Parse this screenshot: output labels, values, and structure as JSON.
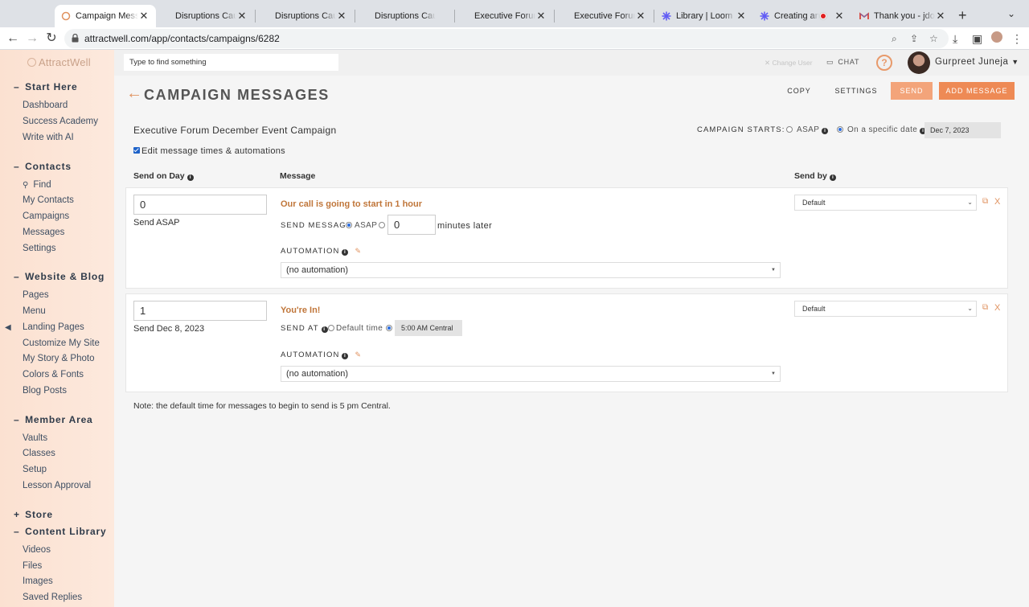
{
  "browser": {
    "tabs": [
      {
        "title": "Campaign Messa",
        "active": true
      },
      {
        "title": "Disruptions Caus",
        "active": false
      },
      {
        "title": "Disruptions Caus",
        "active": false
      },
      {
        "title": "Disruptions Caus",
        "active": false
      },
      {
        "title": "Executive Forum",
        "active": false
      },
      {
        "title": "Executive Forum",
        "active": false
      },
      {
        "title": "Library | Loom",
        "active": false
      },
      {
        "title": "Creating an E",
        "active": false
      },
      {
        "title": "Thank you - jdow",
        "active": false
      }
    ],
    "url": "attractwell.com/app/contacts/campaigns/6282"
  },
  "sidebar": {
    "logo": "AttractWell",
    "sections": [
      {
        "title": "Start Here",
        "symbol": "–",
        "items": [
          "Dashboard",
          "Success Academy",
          "Write with AI"
        ]
      },
      {
        "title": "Contacts",
        "symbol": "–",
        "items": [
          "Find",
          "My Contacts",
          "Campaigns",
          "Messages",
          "Settings"
        ]
      },
      {
        "title": "Website & Blog",
        "symbol": "–",
        "items": [
          "Pages",
          "Menu",
          "Landing Pages",
          "Customize My Site",
          "My Story & Photo",
          "Colors & Fonts",
          "Blog Posts"
        ]
      },
      {
        "title": "Member Area",
        "symbol": "–",
        "items": [
          "Vaults",
          "Classes",
          "Setup",
          "Lesson Approval"
        ]
      },
      {
        "title": "Store",
        "symbol": "+",
        "items": []
      },
      {
        "title": "Content Library",
        "symbol": "–",
        "items": [
          "Videos",
          "Files",
          "Images",
          "Saved Replies"
        ]
      }
    ]
  },
  "topbar": {
    "search_placeholder": "Type to find something",
    "change_user": "Change User",
    "chat": "CHAT",
    "help": "?",
    "user_name": "Gurpreet Juneja"
  },
  "header": {
    "title": "CAMPAIGN MESSAGES",
    "copy": "COPY",
    "settings": "SETTINGS",
    "send": "SEND",
    "add_message": "ADD MESSAGE"
  },
  "campaign": {
    "name": "Executive Forum December Event Campaign",
    "starts_label": "CAMPAIGN STARTS:",
    "asap_label": "ASAP",
    "specific_label": "On a specific date",
    "start_date": "Dec 7, 2023",
    "edit_label": "Edit message times & automations"
  },
  "columns": {
    "day": "Send on Day",
    "message": "Message",
    "send_by": "Send by"
  },
  "messages": [
    {
      "day": "0",
      "send_date": "Send ASAP",
      "title": "Our call is going to start in 1 hour",
      "send_label": "SEND MESSAGE",
      "asap": "ASAP",
      "minutes": "0",
      "minutes_suffix": "minutes later",
      "automation_label": "AUTOMATION",
      "automation": "(no automation)",
      "send_by": "Default"
    },
    {
      "day": "1",
      "send_date": "Send Dec 8, 2023",
      "title": "You're In!",
      "send_label": "SEND AT",
      "default_time": "Default time",
      "time": "5:00 AM Central",
      "automation_label": "AUTOMATION",
      "automation": "(no automation)",
      "send_by": "Default"
    }
  ],
  "note": "Note: the default time for messages to begin to send is 5 pm Central."
}
